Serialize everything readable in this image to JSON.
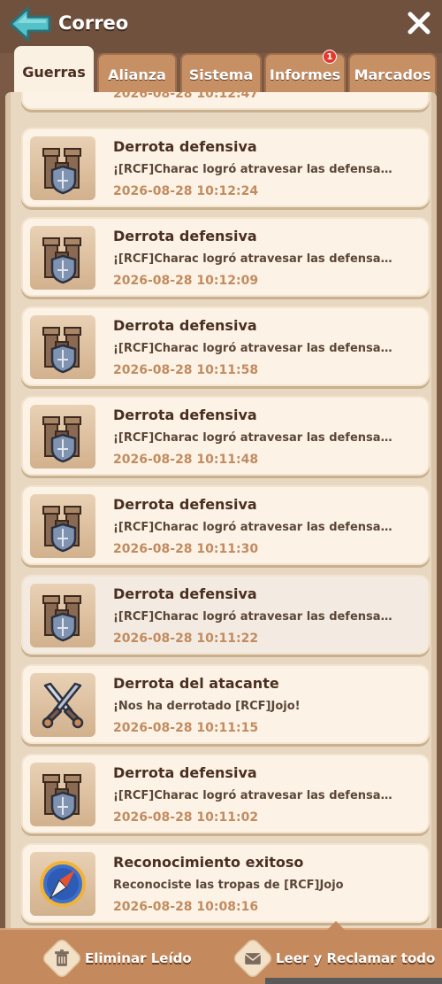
{
  "header": {
    "title": "Correo"
  },
  "tabs": [
    {
      "label": "Guerras",
      "active": true
    },
    {
      "label": "Alianza"
    },
    {
      "label": "Sistema"
    },
    {
      "label": "Informes",
      "badge": "1"
    },
    {
      "label": "Marcados"
    }
  ],
  "partial_card": {
    "time": "2026-08-28 10:12:47"
  },
  "messages": [
    {
      "title": "Derrota defensiva",
      "msg": "¡[RCF]Charac logró atravesar las defensas d...",
      "time": "2026-08-28 10:12:24",
      "icon": "castle-shield-icon"
    },
    {
      "title": "Derrota defensiva",
      "msg": "¡[RCF]Charac logró atravesar las defensas d...",
      "time": "2026-08-28 10:12:09",
      "icon": "castle-shield-icon"
    },
    {
      "title": "Derrota defensiva",
      "msg": "¡[RCF]Charac logró atravesar las defensas d...",
      "time": "2026-08-28 10:11:58",
      "icon": "castle-shield-icon"
    },
    {
      "title": "Derrota defensiva",
      "msg": "¡[RCF]Charac logró atravesar las defensas d...",
      "time": "2026-08-28 10:11:48",
      "icon": "castle-shield-icon"
    },
    {
      "title": "Derrota defensiva",
      "msg": "¡[RCF]Charac logró atravesar las defensas d...",
      "time": "2026-08-28 10:11:30",
      "icon": "castle-shield-icon"
    },
    {
      "title": "Derrota defensiva",
      "msg": "¡[RCF]Charac logró atravesar las defensas d...",
      "time": "2026-08-28 10:11:22",
      "icon": "castle-shield-icon"
    },
    {
      "title": "Derrota del atacante",
      "msg": "¡Nos ha derrotado [RCF]Jojo!",
      "time": "2026-08-28 10:11:15",
      "icon": "crossed-swords-icon"
    },
    {
      "title": "Derrota defensiva",
      "msg": "¡[RCF]Charac logró atravesar las defensas d...",
      "time": "2026-08-28 10:11:02",
      "icon": "castle-shield-icon"
    },
    {
      "title": "Reconocimiento exitoso",
      "msg": "Reconociste las tropas de [RCF]Jojo",
      "time": "2026-08-28 10:08:16",
      "icon": "compass-icon"
    }
  ],
  "footer": {
    "delete_read": "Eliminar Leído",
    "read_claim_all": "Leer y Reclamar todo"
  }
}
